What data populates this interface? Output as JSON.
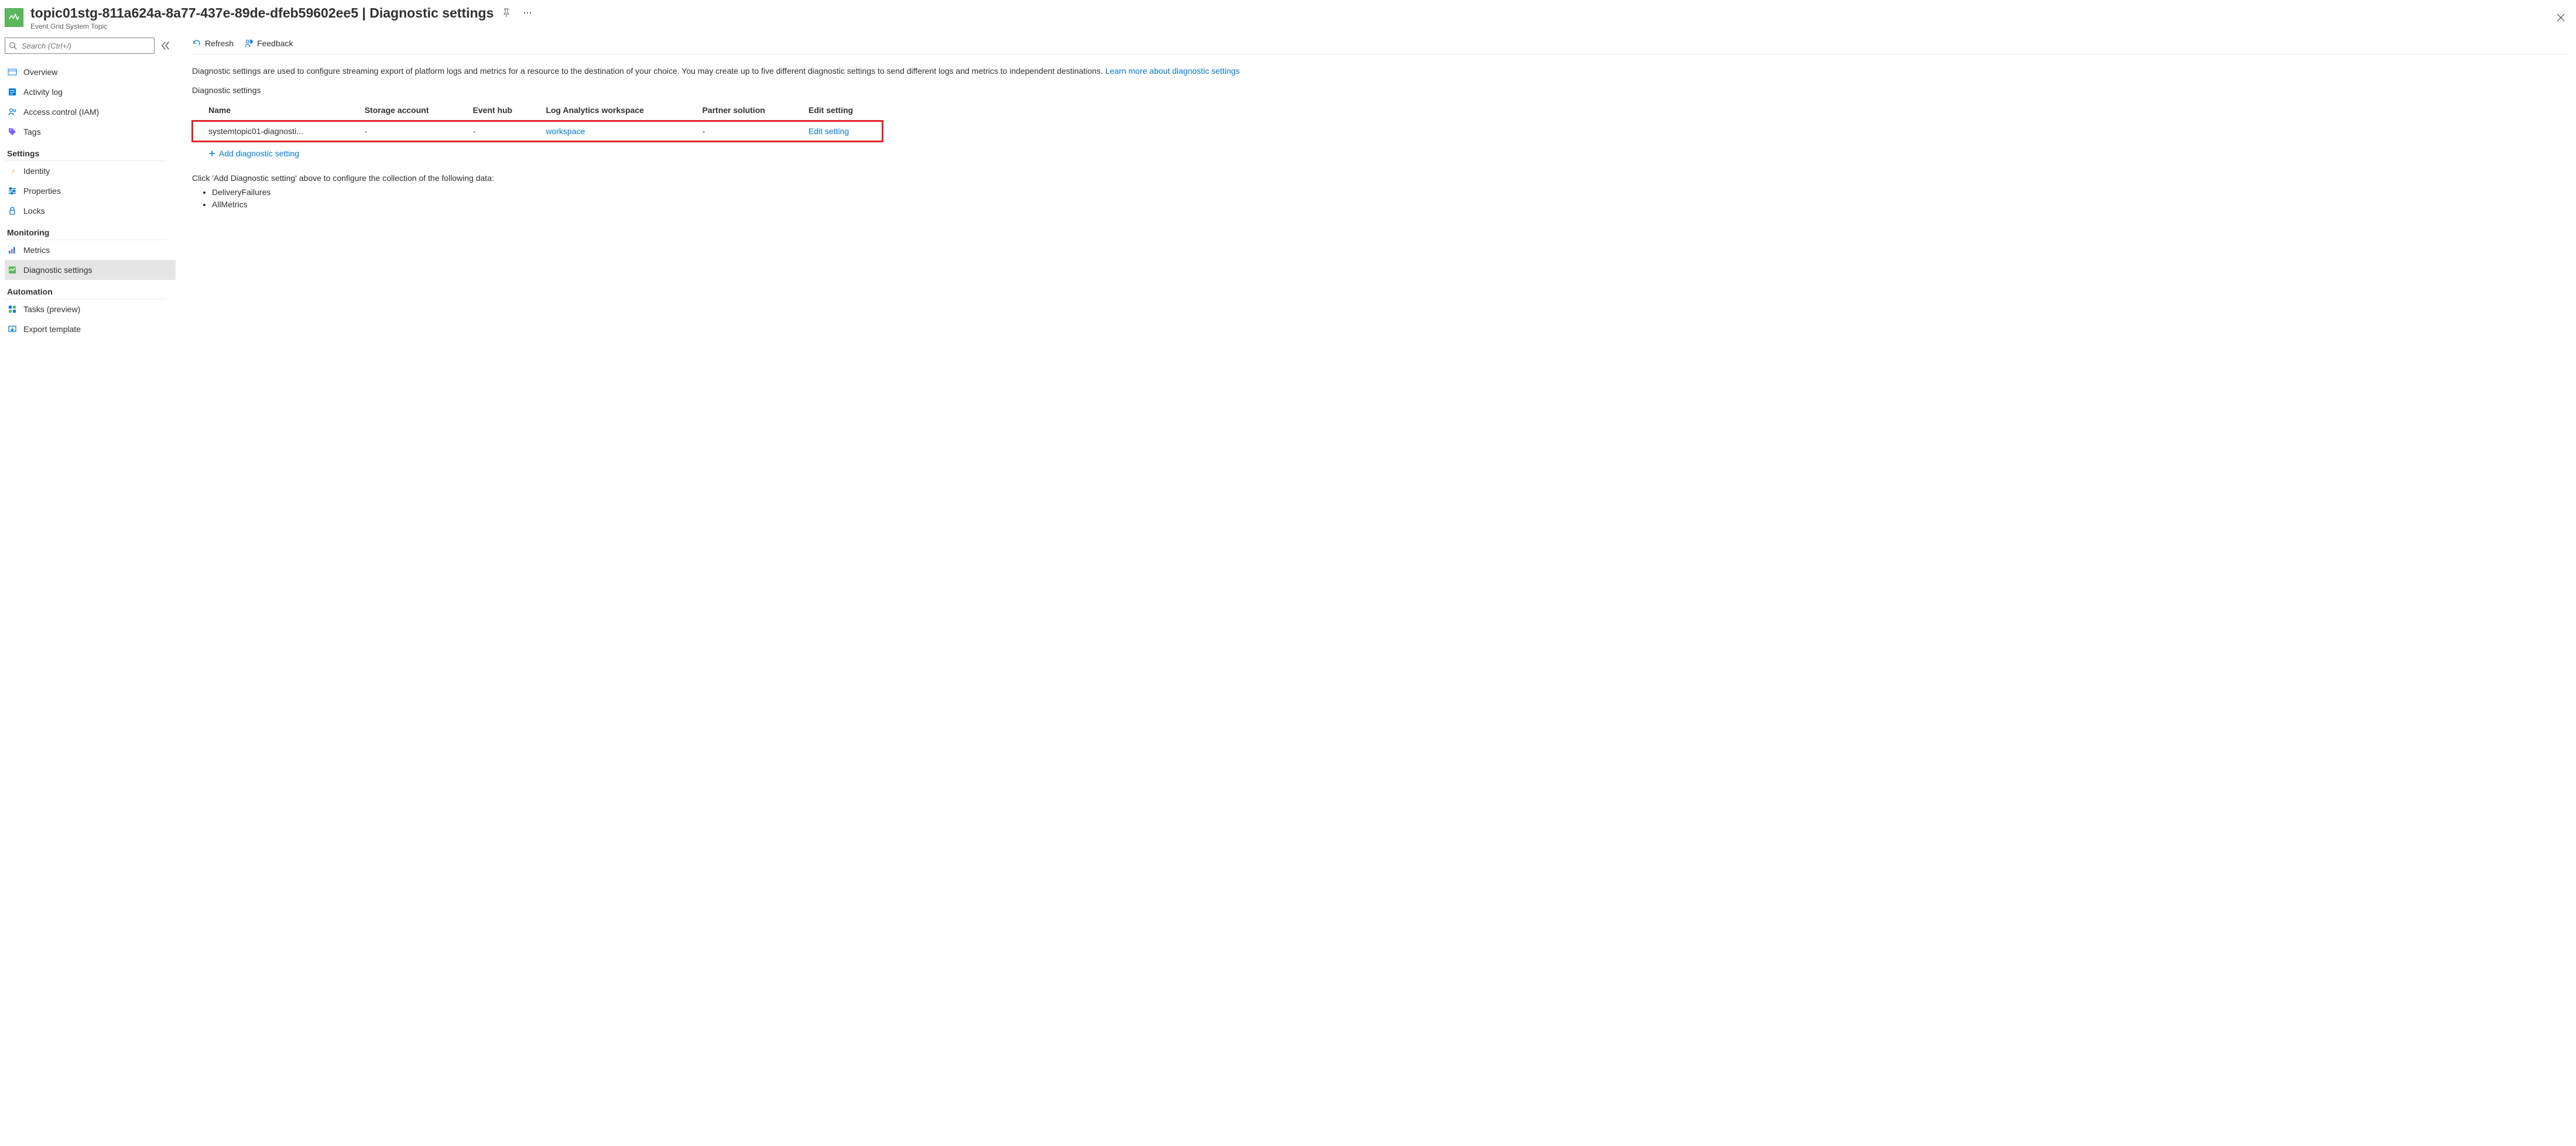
{
  "header": {
    "title": "topic01stg-811a624a-8a77-437e-89de-dfeb59602ee5 | Diagnostic settings",
    "subtitle": "Event Grid System Topic"
  },
  "sidebar": {
    "search_placeholder": "Search (Ctrl+/)",
    "top_items": [
      {
        "key": "overview",
        "label": "Overview"
      },
      {
        "key": "activity-log",
        "label": "Activity log"
      },
      {
        "key": "access-control",
        "label": "Access control (IAM)"
      },
      {
        "key": "tags",
        "label": "Tags"
      }
    ],
    "groups": [
      {
        "key": "settings",
        "label": "Settings",
        "items": [
          {
            "key": "identity",
            "label": "Identity"
          },
          {
            "key": "properties",
            "label": "Properties"
          },
          {
            "key": "locks",
            "label": "Locks"
          }
        ]
      },
      {
        "key": "monitoring",
        "label": "Monitoring",
        "items": [
          {
            "key": "metrics",
            "label": "Metrics"
          },
          {
            "key": "diagnostic-settings",
            "label": "Diagnostic settings",
            "selected": true
          }
        ]
      },
      {
        "key": "automation",
        "label": "Automation",
        "items": [
          {
            "key": "tasks",
            "label": "Tasks (preview)"
          },
          {
            "key": "export-template",
            "label": "Export template"
          }
        ]
      }
    ]
  },
  "toolbar": {
    "refresh_label": "Refresh",
    "feedback_label": "Feedback"
  },
  "intro": {
    "text": "Diagnostic settings are used to configure streaming export of platform logs and metrics for a resource to the destination of your choice. You may create up to five different diagnostic settings to send different logs and metrics to independent destinations. ",
    "link_label": "Learn more about diagnostic settings"
  },
  "section_label": "Diagnostic settings",
  "table": {
    "columns": [
      "Name",
      "Storage account",
      "Event hub",
      "Log Analytics workspace",
      "Partner solution",
      "Edit setting"
    ],
    "rows": [
      {
        "name": "systemtopic01-diagnosti...",
        "storage": "-",
        "eventhub": "-",
        "law": "workspace",
        "partner": "-",
        "edit": "Edit setting"
      }
    ]
  },
  "add_label": "Add diagnostic setting",
  "hint": {
    "prefix": "Click 'Add Diagnostic setting' above to configure the collection of the following data:",
    "items": [
      "DeliveryFailures",
      "AllMetrics"
    ]
  }
}
